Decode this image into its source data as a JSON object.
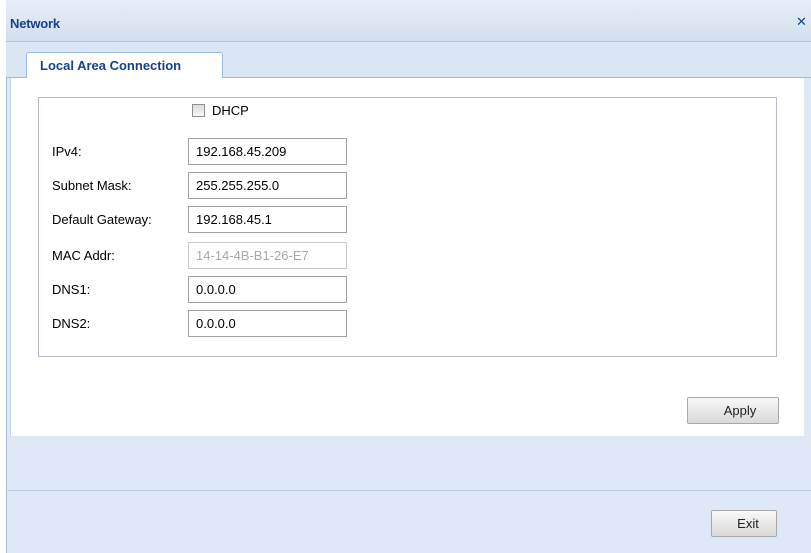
{
  "window": {
    "title": "Network"
  },
  "tabs": [
    {
      "label": "Local Area Connection",
      "active": true
    }
  ],
  "form": {
    "dhcp": {
      "label": "DHCP",
      "checked": false
    },
    "fields": [
      {
        "label": "IPv4:",
        "value": "192.168.45.209",
        "enabled": true
      },
      {
        "label": "Subnet Mask:",
        "value": "255.255.255.0",
        "enabled": true
      },
      {
        "label": "Default Gateway:",
        "value": "192.168.45.1",
        "enabled": true
      },
      {
        "label": "MAC Addr:",
        "value": "14-14-4B-B1-26-E7",
        "enabled": false
      },
      {
        "label": "DNS1:",
        "value": "0.0.0.0",
        "enabled": true
      },
      {
        "label": "DNS2:",
        "value": "0.0.0.0",
        "enabled": true
      }
    ]
  },
  "buttons": {
    "apply": "Apply",
    "exit": "Exit"
  },
  "icons": {
    "close": "close-icon"
  },
  "colors": {
    "title_text": "#15428b",
    "header_bg": "#dfe8f6",
    "disabled_text": "#a8a8a8"
  }
}
